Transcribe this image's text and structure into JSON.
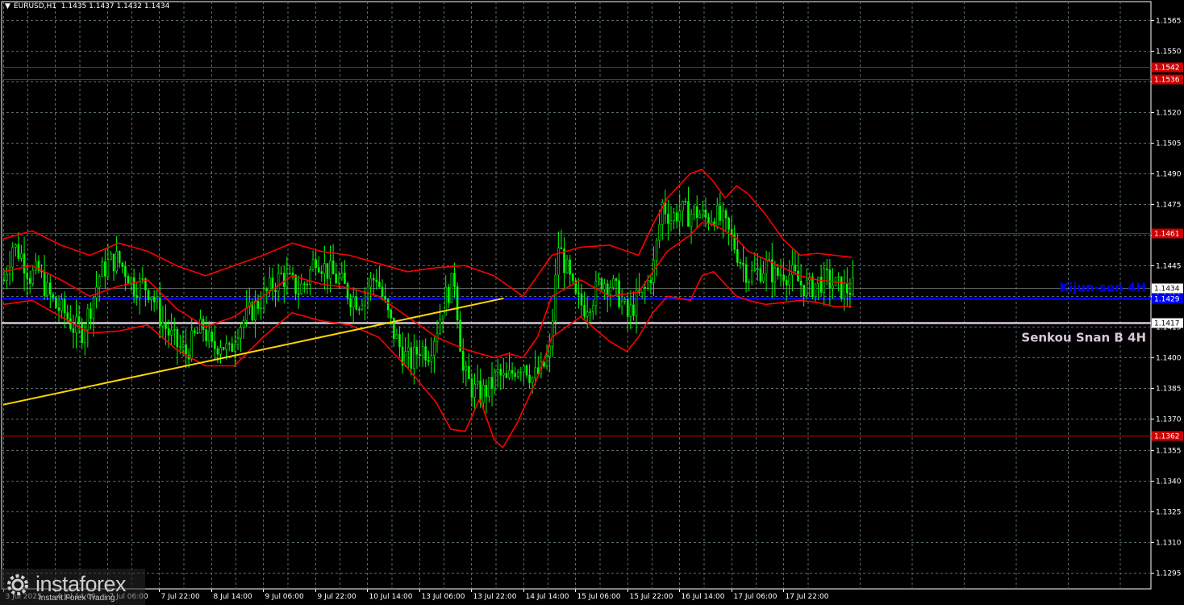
{
  "header": {
    "symbol": "EURUSD,H1",
    "ohlc": "1.1435 1.1437 1.1432 1.1434"
  },
  "logo": {
    "brand": "instaforex",
    "tagline": "Instant Forex Trading"
  },
  "colors": {
    "background": "#000000",
    "grid": "#5a6a6a",
    "candle_up": "#00ff00",
    "candle_down": "#00ff00",
    "bollinger": "#ff0000",
    "level_line": "#cc0000",
    "kijun": "#0000ff",
    "senkou": "#d8c8d8",
    "trendline": "#ffd700",
    "axis_text": "#ffffff"
  },
  "chart_data": {
    "type": "candlestick",
    "price_range": [
      1.1287,
      1.1574
    ],
    "y_ticks": [
      "1.1565",
      "1.1550",
      "1.1535",
      "1.1520",
      "1.1505",
      "1.1490",
      "1.1475",
      "1.1460",
      "1.1445",
      "1.1430",
      "1.1415",
      "1.1400",
      "1.1385",
      "1.1370",
      "1.1355",
      "1.1340",
      "1.1325",
      "1.1310",
      "1.1295"
    ],
    "y_tick_values": [
      1.1565,
      1.155,
      1.1535,
      1.152,
      1.1505,
      1.149,
      1.1475,
      1.146,
      1.1445,
      1.143,
      1.1415,
      1.14,
      1.1385,
      1.137,
      1.1355,
      1.134,
      1.1325,
      1.131,
      1.1295
    ],
    "x_labels": [
      {
        "label": "3 Jul 2025",
        "bar": 0
      },
      {
        "label": "4 Jul 14:00",
        "bar": 16
      },
      {
        "label": "7 Jul 06:00",
        "bar": 32
      },
      {
        "label": "7 Jul 22:00",
        "bar": 48
      },
      {
        "label": "8 Jul 14:00",
        "bar": 64
      },
      {
        "label": "9 Jul 06:00",
        "bar": 80
      },
      {
        "label": "9 Jul 22:00",
        "bar": 96
      },
      {
        "label": "10 Jul 14:00",
        "bar": 112
      },
      {
        "label": "13 Jul 06:00",
        "bar": 128
      },
      {
        "label": "13 Jul 22:00",
        "bar": 144
      },
      {
        "label": "14 Jul 14:00",
        "bar": 160
      },
      {
        "label": "15 Jul 06:00",
        "bar": 176
      },
      {
        "label": "15 Jul 22:00",
        "bar": 192
      },
      {
        "label": "16 Jul 14:00",
        "bar": 208
      },
      {
        "label": "17 Jul 06:00",
        "bar": 224
      },
      {
        "label": "17 Jul 22:00",
        "bar": 240
      }
    ],
    "close_path": [
      [
        0,
        1.1438
      ],
      [
        3,
        1.1455
      ],
      [
        6,
        1.145
      ],
      [
        9,
        1.144
      ],
      [
        12,
        1.1442
      ],
      [
        15,
        1.1432
      ],
      [
        18,
        1.1425
      ],
      [
        21,
        1.1422
      ],
      [
        24,
        1.1415
      ],
      [
        27,
        1.1413
      ],
      [
        30,
        1.1425
      ],
      [
        33,
        1.144
      ],
      [
        36,
        1.1446
      ],
      [
        39,
        1.1448
      ],
      [
        42,
        1.1443
      ],
      [
        45,
        1.1435
      ],
      [
        48,
        1.1436
      ],
      [
        51,
        1.1432
      ],
      [
        54,
        1.142
      ],
      [
        57,
        1.1412
      ],
      [
        60,
        1.1406
      ],
      [
        63,
        1.1402
      ],
      [
        66,
        1.141
      ],
      [
        69,
        1.1415
      ],
      [
        72,
        1.1404
      ],
      [
        75,
        1.1408
      ],
      [
        78,
        1.1402
      ],
      [
        81,
        1.1415
      ],
      [
        84,
        1.142
      ],
      [
        87,
        1.1425
      ],
      [
        90,
        1.143
      ],
      [
        93,
        1.1435
      ],
      [
        96,
        1.144
      ],
      [
        99,
        1.1437
      ],
      [
        102,
        1.1433
      ],
      [
        105,
        1.1438
      ],
      [
        108,
        1.145
      ],
      [
        111,
        1.1444
      ],
      [
        114,
        1.144
      ],
      [
        117,
        1.1436
      ],
      [
        120,
        1.143
      ],
      [
        123,
        1.1428
      ],
      [
        126,
        1.1435
      ],
      [
        129,
        1.144
      ],
      [
        132,
        1.1425
      ],
      [
        135,
        1.1412
      ],
      [
        138,
        1.1402
      ],
      [
        141,
        1.1398
      ],
      [
        144,
        1.1405
      ],
      [
        147,
        1.1403
      ],
      [
        150,
        1.1415
      ],
      [
        153,
        1.143
      ],
      [
        156,
        1.1438
      ],
      [
        159,
        1.1393
      ],
      [
        162,
        1.1385
      ],
      [
        165,
        1.1382
      ],
      [
        168,
        1.1385
      ],
      [
        171,
        1.1392
      ],
      [
        174,
        1.1388
      ],
      [
        177,
        1.1395
      ],
      [
        180,
        1.1398
      ],
      [
        183,
        1.139
      ],
      [
        186,
        1.1393
      ],
      [
        189,
        1.1402
      ],
      [
        192,
        1.1455
      ],
      [
        195,
        1.1442
      ],
      [
        198,
        1.1428
      ],
      [
        201,
        1.1425
      ],
      [
        204,
        1.143
      ],
      [
        207,
        1.1438
      ],
      [
        210,
        1.1436
      ],
      [
        213,
        1.143
      ],
      [
        216,
        1.142
      ],
      [
        219,
        1.1428
      ],
      [
        222,
        1.1433
      ],
      [
        225,
        1.1445
      ],
      [
        228,
        1.1475
      ],
      [
        231,
        1.1468
      ],
      [
        234,
        1.1472
      ],
      [
        237,
        1.147
      ],
      [
        240,
        1.1471
      ],
      [
        243,
        1.1468
      ],
      [
        246,
        1.147
      ],
      [
        249,
        1.1466
      ],
      [
        252,
        1.1458
      ],
      [
        255,
        1.1448
      ],
      [
        258,
        1.144
      ],
      [
        261,
        1.1442
      ],
      [
        264,
        1.1445
      ],
      [
        267,
        1.144
      ],
      [
        270,
        1.1442
      ],
      [
        273,
        1.144
      ],
      [
        276,
        1.1436
      ],
      [
        279,
        1.1434
      ],
      [
        282,
        1.1437
      ],
      [
        285,
        1.1438
      ],
      [
        288,
        1.1435
      ],
      [
        291,
        1.1433
      ],
      [
        294,
        1.1434
      ]
    ],
    "bollinger_upper": [
      [
        0,
        1.1458
      ],
      [
        10,
        1.1462
      ],
      [
        20,
        1.1455
      ],
      [
        30,
        1.145
      ],
      [
        40,
        1.1456
      ],
      [
        50,
        1.1452
      ],
      [
        60,
        1.1445
      ],
      [
        70,
        1.144
      ],
      [
        80,
        1.1445
      ],
      [
        90,
        1.145
      ],
      [
        100,
        1.1456
      ],
      [
        110,
        1.1452
      ],
      [
        120,
        1.145
      ],
      [
        130,
        1.1446
      ],
      [
        140,
        1.1442
      ],
      [
        150,
        1.1444
      ],
      [
        160,
        1.1445
      ],
      [
        170,
        1.144
      ],
      [
        175,
        1.1435
      ],
      [
        180,
        1.143
      ],
      [
        185,
        1.144
      ],
      [
        190,
        1.145
      ],
      [
        200,
        1.1454
      ],
      [
        210,
        1.1455
      ],
      [
        220,
        1.145
      ],
      [
        225,
        1.1465
      ],
      [
        230,
        1.1478
      ],
      [
        238,
        1.149
      ],
      [
        242,
        1.1492
      ],
      [
        246,
        1.1486
      ],
      [
        250,
        1.1478
      ],
      [
        254,
        1.1484
      ],
      [
        258,
        1.148
      ],
      [
        264,
        1.147
      ],
      [
        270,
        1.1458
      ],
      [
        276,
        1.145
      ],
      [
        282,
        1.1451
      ],
      [
        288,
        1.145
      ],
      [
        294,
        1.1449
      ]
    ],
    "bollinger_mid": [
      [
        0,
        1.1442
      ],
      [
        10,
        1.1445
      ],
      [
        20,
        1.1438
      ],
      [
        30,
        1.143
      ],
      [
        40,
        1.1435
      ],
      [
        50,
        1.1438
      ],
      [
        60,
        1.1424
      ],
      [
        70,
        1.1415
      ],
      [
        80,
        1.142
      ],
      [
        90,
        1.143
      ],
      [
        100,
        1.144
      ],
      [
        110,
        1.1436
      ],
      [
        120,
        1.1434
      ],
      [
        130,
        1.143
      ],
      [
        140,
        1.142
      ],
      [
        150,
        1.141
      ],
      [
        160,
        1.1404
      ],
      [
        170,
        1.14
      ],
      [
        175,
        1.1402
      ],
      [
        180,
        1.14
      ],
      [
        185,
        1.141
      ],
      [
        190,
        1.143
      ],
      [
        200,
        1.1438
      ],
      [
        210,
        1.143
      ],
      [
        220,
        1.1432
      ],
      [
        225,
        1.1442
      ],
      [
        230,
        1.1452
      ],
      [
        238,
        1.146
      ],
      [
        242,
        1.1466
      ],
      [
        246,
        1.1465
      ],
      [
        250,
        1.1462
      ],
      [
        254,
        1.1458
      ],
      [
        258,
        1.1452
      ],
      [
        264,
        1.1448
      ],
      [
        270,
        1.1444
      ],
      [
        276,
        1.144
      ],
      [
        282,
        1.1438
      ],
      [
        288,
        1.1437
      ],
      [
        294,
        1.1436
      ]
    ],
    "bollinger_lower": [
      [
        0,
        1.1426
      ],
      [
        10,
        1.1428
      ],
      [
        20,
        1.142
      ],
      [
        30,
        1.1412
      ],
      [
        40,
        1.1413
      ],
      [
        50,
        1.1416
      ],
      [
        60,
        1.1404
      ],
      [
        70,
        1.1396
      ],
      [
        80,
        1.1396
      ],
      [
        90,
        1.141
      ],
      [
        100,
        1.1422
      ],
      [
        110,
        1.1418
      ],
      [
        120,
        1.1416
      ],
      [
        130,
        1.141
      ],
      [
        140,
        1.1395
      ],
      [
        150,
        1.1378
      ],
      [
        155,
        1.1365
      ],
      [
        160,
        1.1364
      ],
      [
        165,
        1.138
      ],
      [
        170,
        1.136
      ],
      [
        173,
        1.1356
      ],
      [
        178,
        1.1368
      ],
      [
        185,
        1.139
      ],
      [
        190,
        1.141
      ],
      [
        200,
        1.142
      ],
      [
        210,
        1.1408
      ],
      [
        216,
        1.1403
      ],
      [
        220,
        1.141
      ],
      [
        225,
        1.1422
      ],
      [
        230,
        1.143
      ],
      [
        238,
        1.1428
      ],
      [
        242,
        1.144
      ],
      [
        246,
        1.1442
      ],
      [
        250,
        1.1436
      ],
      [
        254,
        1.143
      ],
      [
        258,
        1.1428
      ],
      [
        264,
        1.1426
      ],
      [
        270,
        1.1427
      ],
      [
        276,
        1.1428
      ],
      [
        282,
        1.1427
      ],
      [
        288,
        1.1425
      ],
      [
        294,
        1.1425
      ]
    ],
    "levels": [
      {
        "label": "1.1542",
        "value": 1.1542
      },
      {
        "label": "1.1536",
        "value": 1.1536
      },
      {
        "label": "1.1461",
        "value": 1.1461
      },
      {
        "label": "1.1362",
        "value": 1.1362
      }
    ],
    "kijun": {
      "label": "Kijun-sen 4H",
      "value": 1.1429,
      "price_label": "1.1429"
    },
    "senkou": {
      "label": "Senkou Snan B 4H",
      "value": 1.1417,
      "price_label": "1.1417"
    },
    "current_price": {
      "label": "1.1434",
      "value": 1.1434
    },
    "trendline": {
      "from": [
        0,
        1.1377
      ],
      "to": [
        137,
        1.1429
      ]
    }
  }
}
